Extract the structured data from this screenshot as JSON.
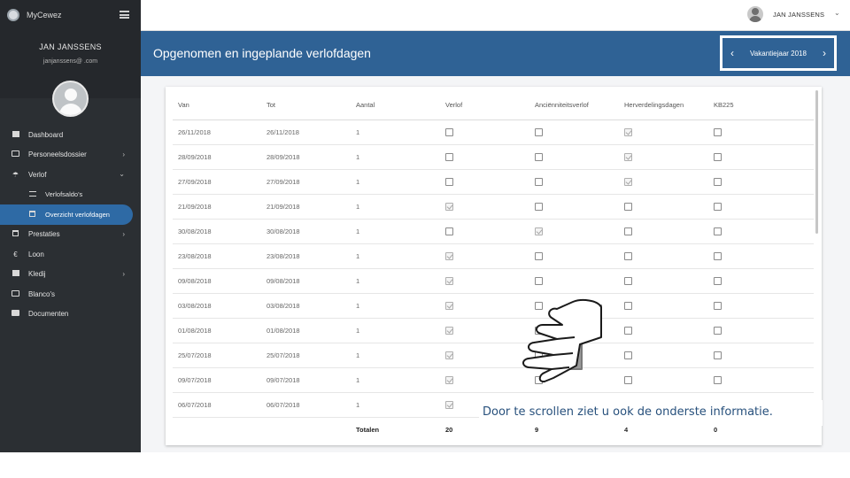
{
  "app": {
    "brand": "MyCewez"
  },
  "sidebar": {
    "user_name": "JAN JANSSENS",
    "user_email": "janjanssens@          .com",
    "items": [
      {
        "label": "Dashboard",
        "icon": "dashboard-icon",
        "chevron": ""
      },
      {
        "label": "Personeelsdossier",
        "icon": "id-card-icon",
        "chevron": "›"
      },
      {
        "label": "Verlof",
        "icon": "palm-tree-icon",
        "chevron": "⌄"
      },
      {
        "label": "Verlofsaldo's",
        "icon": "list-icon",
        "chevron": ""
      },
      {
        "label": "Overzicht verlofdagen",
        "icon": "calendar-icon",
        "chevron": ""
      },
      {
        "label": "Prestaties",
        "icon": "calendar-grid-icon",
        "chevron": "›"
      },
      {
        "label": "Loon",
        "icon": "euro-icon",
        "chevron": ""
      },
      {
        "label": "Kledij",
        "icon": "shirt-icon",
        "chevron": "›"
      },
      {
        "label": "Blanco's",
        "icon": "inbox-icon",
        "chevron": ""
      },
      {
        "label": "Documenten",
        "icon": "folder-icon",
        "chevron": ""
      }
    ]
  },
  "topbar": {
    "user": "JAN JANSSENS",
    "caret": "⌄"
  },
  "header": {
    "title": "Opgenomen en ingeplande verlofdagen",
    "year_label": "Vakantiejaar 2018",
    "prev": "‹",
    "next": "›"
  },
  "table": {
    "columns": [
      "Van",
      "Tot",
      "Aantal",
      "Verlof",
      "Anciënniteitsverlof",
      "Herverdelingsdagen",
      "KB225"
    ],
    "rows": [
      {
        "van": "26/11/2018",
        "tot": "26/11/2018",
        "aantal": "1",
        "checks": [
          false,
          false,
          true,
          false
        ]
      },
      {
        "van": "28/09/2018",
        "tot": "28/09/2018",
        "aantal": "1",
        "checks": [
          false,
          false,
          true,
          false
        ]
      },
      {
        "van": "27/09/2018",
        "tot": "27/09/2018",
        "aantal": "1",
        "checks": [
          false,
          false,
          true,
          false
        ]
      },
      {
        "van": "21/09/2018",
        "tot": "21/09/2018",
        "aantal": "1",
        "checks": [
          true,
          false,
          false,
          false
        ]
      },
      {
        "van": "30/08/2018",
        "tot": "30/08/2018",
        "aantal": "1",
        "checks": [
          false,
          true,
          false,
          false
        ]
      },
      {
        "van": "23/08/2018",
        "tot": "23/08/2018",
        "aantal": "1",
        "checks": [
          true,
          false,
          false,
          false
        ]
      },
      {
        "van": "09/08/2018",
        "tot": "09/08/2018",
        "aantal": "1",
        "checks": [
          true,
          false,
          false,
          false
        ]
      },
      {
        "van": "03/08/2018",
        "tot": "03/08/2018",
        "aantal": "1",
        "checks": [
          true,
          false,
          false,
          false
        ]
      },
      {
        "van": "01/08/2018",
        "tot": "01/08/2018",
        "aantal": "1",
        "checks": [
          true,
          false,
          false,
          false
        ]
      },
      {
        "van": "25/07/2018",
        "tot": "25/07/2018",
        "aantal": "1",
        "checks": [
          true,
          false,
          false,
          false
        ]
      },
      {
        "van": "09/07/2018",
        "tot": "09/07/2018",
        "aantal": "1",
        "checks": [
          true,
          false,
          false,
          false
        ]
      },
      {
        "van": "06/07/2018",
        "tot": "06/07/2018",
        "aantal": "1",
        "checks": [
          true,
          false,
          false,
          false
        ]
      }
    ],
    "totals": {
      "label": "Totalen",
      "verlof": "20",
      "ancienniteit": "9",
      "herverdeling": "4",
      "kb225": "0"
    }
  },
  "annotation": {
    "caption": "Door te scrollen ziet u ook de onderste informatie.",
    "icon": "scroll-hand-icon"
  }
}
